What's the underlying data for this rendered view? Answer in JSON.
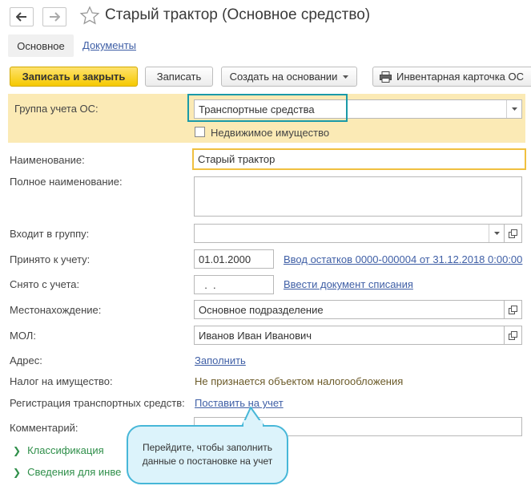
{
  "window": {
    "title": "Старый трактор (Основное средство)"
  },
  "tabs": {
    "main": "Основное",
    "documents": "Документы"
  },
  "toolbar": {
    "save_close": "Записать и закрыть",
    "save": "Записать",
    "create_based": "Создать на основании",
    "inventory_card": "Инвентарная карточка ОС"
  },
  "form": {
    "group_label": "Группа учета ОС:",
    "group_value": "Транспортные средства",
    "realty_label": "Недвижимое имущество",
    "name_label": "Наименование:",
    "name_value": "Старый трактор",
    "fullname_label": "Полное наименование:",
    "fullname_value": "",
    "ingroup_label": "Входит в группу:",
    "ingroup_value": "",
    "accepted_label": "Принято к учету:",
    "accepted_value": "01.01.2000",
    "accepted_link": "Ввод остатков 0000-000004 от 31.12.2018 0:00:00",
    "removed_label": "Снято с учета:",
    "removed_value": "  .  .",
    "removed_link": "Ввести документ списания",
    "location_label": "Местонахождение:",
    "location_value": "Основное подразделение",
    "mol_label": "МОЛ:",
    "mol_value": "Иванов Иван Иванович",
    "address_label": "Адрес:",
    "address_link": "Заполнить",
    "tax_label": "Налог на имущество:",
    "tax_value": "Не признается объектом налогообложения",
    "reg_label": "Регистрация транспортных средств:",
    "reg_link": "Поставить на учет",
    "comment_label": "Комментарий:",
    "comment_value": ""
  },
  "sections": {
    "classification": "Классификация",
    "inventory": "Сведения для инве"
  },
  "tooltip": {
    "text": "Перейдите, чтобы заполнить данные о постановке на учет"
  },
  "colors": {
    "accent": "#f5c900",
    "link": "#3f5fa6",
    "panel": "#fbeab5",
    "highlight": "#1a9aa8"
  }
}
